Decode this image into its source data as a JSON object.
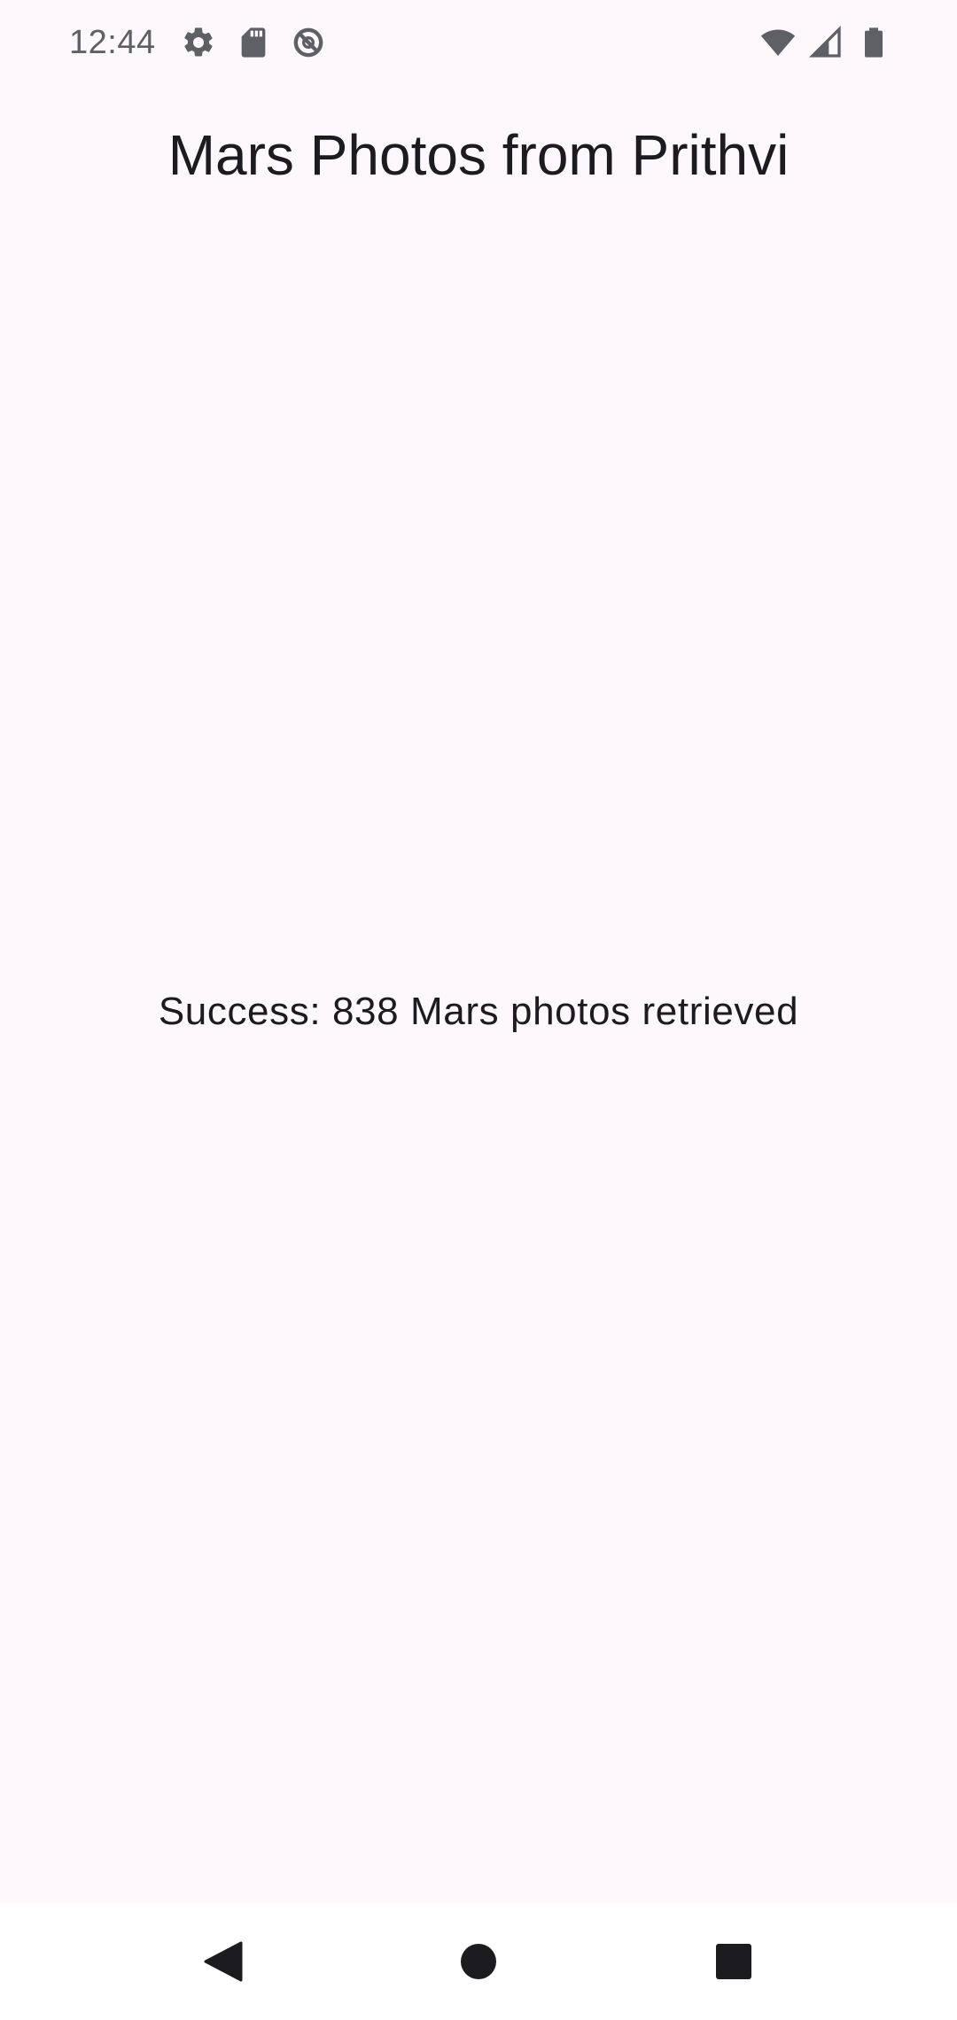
{
  "status_bar": {
    "time": "12:44",
    "left_icons": [
      "settings-icon",
      "sd-card-icon",
      "do-not-disturb-icon"
    ],
    "right_icons": [
      "wifi-icon",
      "cellular-signal-icon",
      "battery-icon"
    ]
  },
  "app": {
    "title": "Mars Photos from Prithvi"
  },
  "main": {
    "message": "Success: 838 Mars photos retrieved"
  },
  "nav_bar": {
    "buttons": [
      "back-icon",
      "home-icon",
      "recents-icon"
    ]
  },
  "colors": {
    "background": "#fdf8fc",
    "text": "#1c1b1f",
    "status_icons": "#5f5f66",
    "nav_bar": "#ffffff"
  }
}
